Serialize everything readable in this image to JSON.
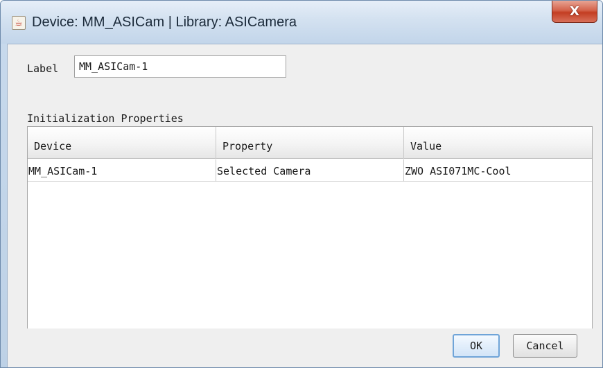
{
  "window": {
    "title": "Device: MM_ASICam | Library: ASICamera",
    "close_glyph": "X",
    "app_icon": "java-cup-icon"
  },
  "form": {
    "label_caption": "Label",
    "label_value": "MM_ASICam-1",
    "section_caption": "Initialization Properties"
  },
  "table": {
    "headers": [
      "Device",
      "Property",
      "Value"
    ],
    "rows": [
      [
        "MM_ASICam-1",
        "Selected Camera",
        "ZWO ASI071MC-Cool"
      ]
    ]
  },
  "buttons": {
    "ok_label": "OK",
    "cancel_label": "Cancel"
  },
  "colors": {
    "close_button": "#c33d22",
    "ok_border": "#6fa4d8"
  }
}
